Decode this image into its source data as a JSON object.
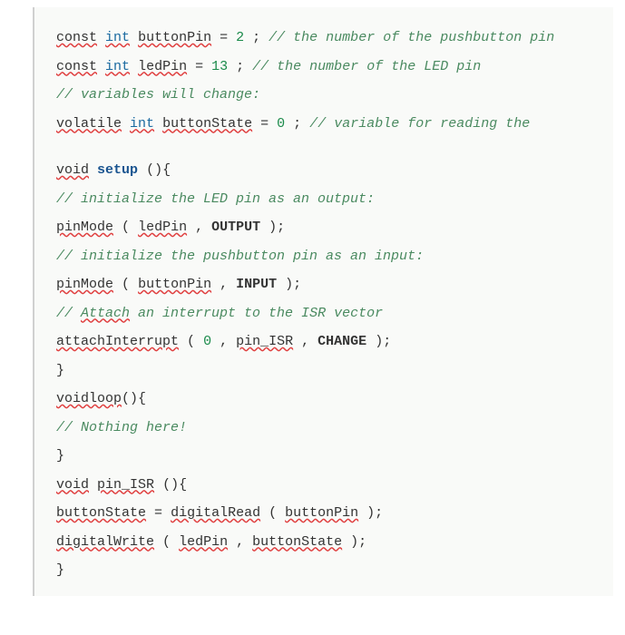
{
  "lines": {
    "l1_const": "const",
    "l1_int": "int",
    "l1_var": "buttonPin",
    "l1_eq": " = ",
    "l1_val": "2",
    "l1_semi": ";",
    "l1_pad": "       ",
    "l1_comment": "// the number of the pushbutton pin",
    "l2_const": "const",
    "l2_int": "int",
    "l2_var": "ledPin",
    "l2_eq": " =  ",
    "l2_val": "13",
    "l2_semi": ";",
    "l2_pad": "       ",
    "l2_comment": "// the number of the LED pin",
    "l3_comment": "// variables will change:",
    "l4_vol": "volatile",
    "l4_int": "int",
    "l4_var": "buttonState",
    "l4_eq": " = ",
    "l4_val": "0",
    "l4_semi": ";",
    "l4_pad": "          ",
    "l4_comment": "// variable for reading the",
    "l5_void": "void",
    "l5_func": " setup",
    "l5_paren": "(){",
    "l6_comment": "// initialize the LED pin as an output:",
    "l7_func": "pinMode",
    "l7_open": "(",
    "l7_arg1": "ledPin",
    "l7_sep": ", ",
    "l7_arg2": "OUTPUT",
    "l7_close": ");",
    "l8_comment": "// initialize the pushbutton pin as an input:",
    "l9_func": "pinMode",
    "l9_open": "(",
    "l9_arg1": "buttonPin",
    "l9_sep": ", ",
    "l9_arg2": "INPUT",
    "l9_close": ");",
    "l10_comment": "// ",
    "l10_attach": "Attach",
    "l10_rest": " an interrupt to the ISR vector",
    "l11_func": "attachInterrupt",
    "l11_open": "(",
    "l11_arg1": "0",
    "l11_sep1": ", ",
    "l11_arg2": "pin_ISR",
    "l11_sep2": ", ",
    "l11_arg3": "CHANGE",
    "l11_close": ");",
    "l12_brace": "}",
    "l13_void": "void",
    "l13_func": "loop",
    "l13_paren": "(){",
    "l14_comment": "// Nothing here!",
    "l15_brace": "}",
    "l16_void": "void",
    "l16_sp": " ",
    "l16_func": "pin_ISR",
    "l16_paren": "(){",
    "l17_var": "buttonState",
    "l17_eq": " = ",
    "l17_func": "digitalRead",
    "l17_open": "(",
    "l17_arg": "buttonPin",
    "l17_close": ");",
    "l18_func": "digitalWrite",
    "l18_open": "(",
    "l18_arg1": "ledPin",
    "l18_sep": ", ",
    "l18_arg2": "buttonState",
    "l18_close": ");",
    "l19_brace": "}"
  }
}
